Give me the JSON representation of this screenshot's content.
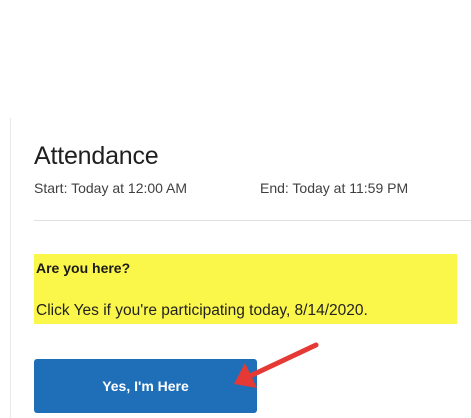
{
  "attendance": {
    "title": "Attendance",
    "start": "Start: Today at 12:00 AM",
    "end": "End: Today at 11:59 PM",
    "question": "Are you here?",
    "instruction": "Click Yes if you're participating today, 8/14/2020.",
    "button_label": "Yes, I'm Here"
  },
  "colors": {
    "highlight": "#fbf64a",
    "button": "#1e6fb8",
    "arrow": "#e53935"
  },
  "icons": {
    "annotation": "red-arrow-icon"
  }
}
